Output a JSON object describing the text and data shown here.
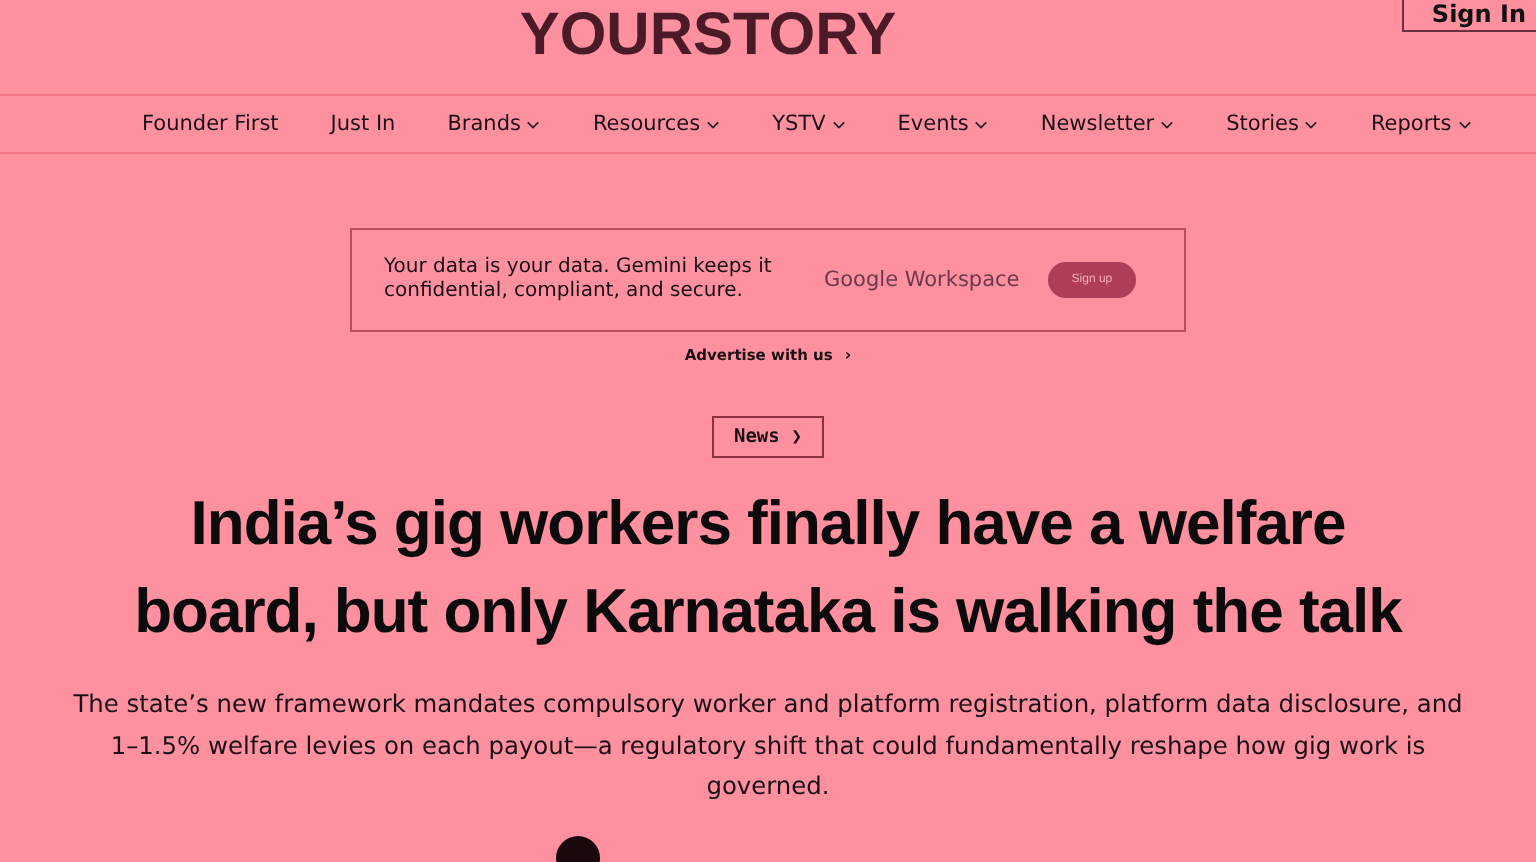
{
  "header": {
    "logo": "YOURSTORY",
    "sign_in": "Sign In"
  },
  "nav": [
    {
      "label": "Founder First",
      "has_menu": false
    },
    {
      "label": "Just In",
      "has_menu": false
    },
    {
      "label": "Brands",
      "has_menu": true
    },
    {
      "label": "Resources",
      "has_menu": true
    },
    {
      "label": "YSTV",
      "has_menu": true
    },
    {
      "label": "Events",
      "has_menu": true
    },
    {
      "label": "Newsletter",
      "has_menu": true
    },
    {
      "label": "Stories",
      "has_menu": true
    },
    {
      "label": "Reports",
      "has_menu": true
    }
  ],
  "ad": {
    "text": "Your data is your data. Gemini keeps it confidential, compliant, and secure.",
    "brand": "Google Workspace",
    "button": "Sign up",
    "advertise_link": "Advertise with us",
    "advertise_arrow": "›"
  },
  "article": {
    "category": "News",
    "category_arrow": "❯",
    "headline": "India’s gig workers finally have a welfare board, but only Karnataka is walking the talk",
    "summary": "The state’s new framework mandates compulsory worker and platform registration, platform data disclosure, and 1–1.5% welfare levies on each payout—a regulatory shift that could fundamentally reshape how gig work is governed."
  }
}
